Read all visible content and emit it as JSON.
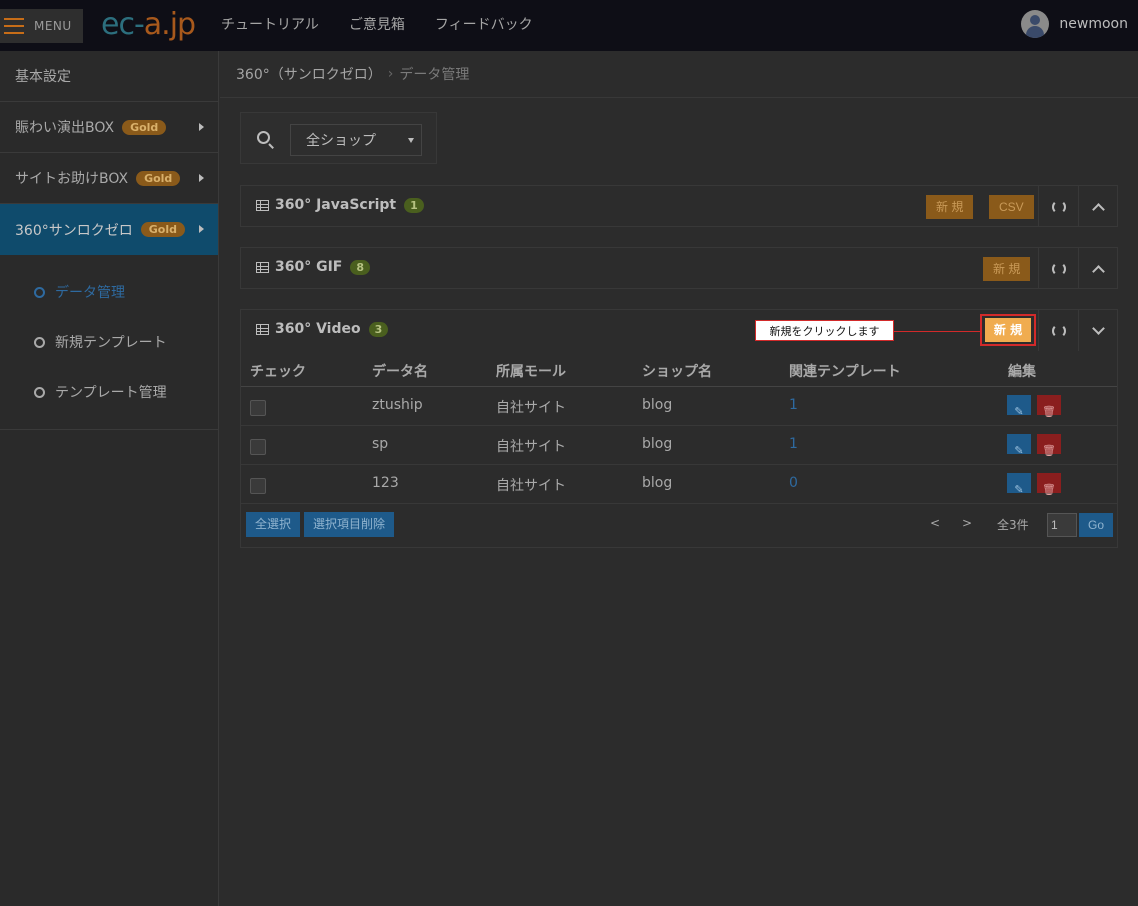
{
  "topbar": {
    "menu_label": "MENU",
    "logo_part1": "ec-",
    "logo_part2": "a.jp",
    "nav": [
      "チュートリアル",
      "ご意見箱",
      "フィードバック"
    ],
    "username": "newmoon"
  },
  "sidebar": {
    "items": [
      {
        "label": "基本設定",
        "badge": ""
      },
      {
        "label": "賑わい演出BOX",
        "badge": "Gold"
      },
      {
        "label": "サイトお助けBOX",
        "badge": "Gold"
      },
      {
        "label": "360°サンロクゼロ",
        "badge": "Gold"
      }
    ],
    "sub_items": [
      "データ管理",
      "新規テンプレート",
      "テンプレート管理"
    ]
  },
  "breadcrumb": {
    "root": "360°（サンロクゼロ）",
    "separator": "›",
    "current": "データ管理"
  },
  "search": {
    "shop_select_value": "全ショップ"
  },
  "panels": {
    "js": {
      "title": "360° JavaScript",
      "count": "1",
      "new_label": "新 規",
      "csv_label": "CSV"
    },
    "gif": {
      "title": "360° GIF",
      "count": "8",
      "new_label": "新 規"
    },
    "video": {
      "title": "360° Video",
      "count": "3",
      "new_label": "新 規"
    }
  },
  "callout": {
    "text": "新規をクリックします"
  },
  "table": {
    "headers": [
      "チェック",
      "データ名",
      "所属モール",
      "ショップ名",
      "関連テンプレート",
      "編集"
    ],
    "rows": [
      {
        "name": "ztuship",
        "mall": "自社サイト",
        "shop": "blog",
        "templates": "1"
      },
      {
        "name": "sp",
        "mall": "自社サイト",
        "shop": "blog",
        "templates": "1"
      },
      {
        "name": "123",
        "mall": "自社サイト",
        "shop": "blog",
        "templates": "0"
      }
    ],
    "select_all_label": "全選択",
    "delete_selected_label": "選択項目削除",
    "prev_label": "<",
    "next_label": ">",
    "total_label": "全3件",
    "page_value": "1",
    "go_label": "Go"
  },
  "colors": {
    "accent_orange": "#f0ac4f",
    "highlight_red": "#d22a2a",
    "primary_blue": "#1e5a8a",
    "danger_red": "#8a1e1e"
  }
}
